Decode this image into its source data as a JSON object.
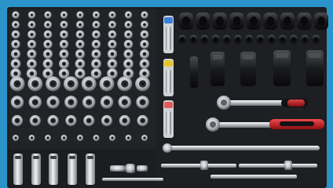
{
  "image": {
    "subject": "tool-tray",
    "frame_color": "#2a93c9",
    "tray_color": "#1c1d20",
    "metal_color": "#d9dce0",
    "handle_color": "#c7161c",
    "accent_colors": [
      "#3b7fd6",
      "#e6c42a",
      "#e05a5a"
    ]
  }
}
